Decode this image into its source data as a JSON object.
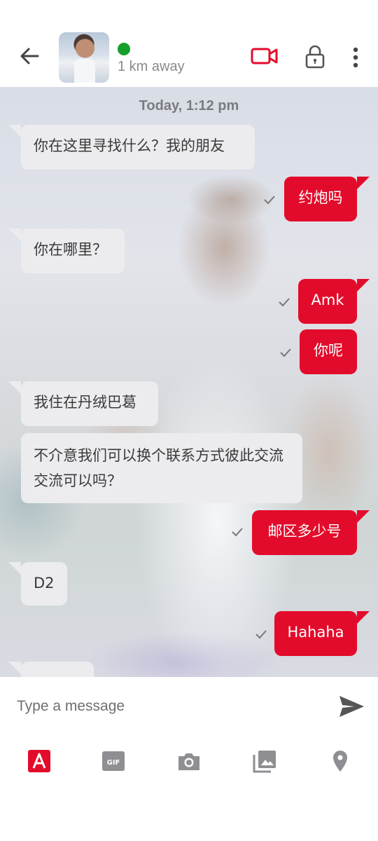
{
  "header": {
    "distance": "1 km away",
    "online_color": "#159f2a",
    "icons": [
      "back-arrow-icon",
      "profile-avatar",
      "video-call-icon",
      "lock-icon",
      "more-vertical-icon"
    ]
  },
  "chat": {
    "timestamp": "Today, 1:12 pm",
    "messages": [
      {
        "direction": "in",
        "text": "你在这里寻找什么？我的朋友"
      },
      {
        "direction": "out",
        "text": "约炮吗",
        "status": "sent"
      },
      {
        "direction": "in",
        "text": "你在哪里？"
      },
      {
        "direction": "out",
        "text": "Amk",
        "status": "sent"
      },
      {
        "direction": "out",
        "text": "你呢",
        "status": "sent"
      },
      {
        "direction": "in",
        "text": "我住在丹绒巴葛"
      },
      {
        "direction": "in",
        "text": "不介意我们可以换个联系方式彼此交流交流可以吗？"
      },
      {
        "direction": "out",
        "text": "邮区多少号",
        "status": "sent"
      },
      {
        "direction": "in",
        "text": "D2"
      },
      {
        "direction": "out",
        "text": "Hahaha",
        "status": "sent"
      }
    ]
  },
  "composer": {
    "placeholder": "Type a message",
    "tools": [
      "text-style-icon",
      "gif-icon",
      "camera-icon",
      "gallery-icon",
      "location-icon"
    ]
  },
  "colors": {
    "accent": "#e30b2b",
    "incoming_bubble": "#ececef"
  }
}
